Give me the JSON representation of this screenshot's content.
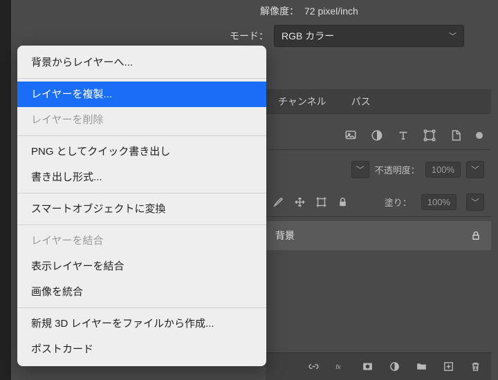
{
  "top": {
    "resolution_label": "解像度：",
    "resolution_value": "72 pixel/inch",
    "mode_label": "モード：",
    "mode_value": "RGB カラー"
  },
  "panel": {
    "tabs": {
      "channel": "チャンネル",
      "path": "パス"
    },
    "opacity_label": "不透明度：",
    "opacity_value": "100%",
    "fill_label": "塗り：",
    "fill_value": "100%"
  },
  "layer": {
    "name": "背景"
  },
  "menu": {
    "bg_to_layer": "背景からレイヤーへ...",
    "duplicate": "レイヤーを複製...",
    "delete": "レイヤーを削除",
    "quick_png": "PNG としてクイック書き出し",
    "export_as": "書き出し形式...",
    "to_smart": "スマートオブジェクトに変換",
    "merge": "レイヤーを結合",
    "merge_visible": "表示レイヤーを結合",
    "flatten": "画像を統合",
    "new3d": "新規 3D レイヤーをファイルから作成...",
    "postcard": "ポストカード"
  }
}
